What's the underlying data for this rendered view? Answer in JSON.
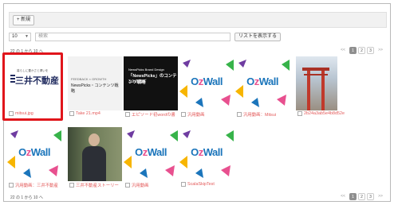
{
  "topbar": {
    "new_label": "+ 新規"
  },
  "toolbar": {
    "per_page_value": "10",
    "search_placeholder": "検索",
    "list_button_label": "リストを表示する"
  },
  "pagination": {
    "count_top": "22 の 1 から 10 へ",
    "count_bottom": "22 の 1 から 10 へ",
    "prev": "<<",
    "next": ">>",
    "pages": [
      "1",
      "2",
      "3"
    ],
    "current": "1"
  },
  "thumbnails": {
    "mitsui_tagline": "暮らしに豊かさと潤いを",
    "mitsui_logo": "三井不動産",
    "newspicks_top": "FEEDBACK × GROWTH",
    "newspicks_title": "NewsPicks・コンテンツ戦略",
    "dark_small": "NewsPicks Brand Design",
    "dark_title": "「NewsPicks」のコンテンツ戦略",
    "dark_sub": "3つのカギ",
    "ozwall_word_a": "O",
    "ozwall_word_b": "z",
    "ozwall_word_c": "Wall"
  },
  "items": [
    {
      "caption": "mitsui.jpg"
    },
    {
      "caption": "Take 21.mp4"
    },
    {
      "caption": "エピソード初wordの書"
    },
    {
      "caption": "汎用動画"
    },
    {
      "caption": "汎用動画：Mitsui"
    },
    {
      "caption": "2b24a3ab5e4b8d52e"
    },
    {
      "caption": "汎用動画：三井不動産"
    },
    {
      "caption": "三井不動産ストーリー"
    },
    {
      "caption": "汎用動画"
    },
    {
      "caption": "ScalaSkipTest"
    }
  ],
  "colors": {
    "highlight": "#e0151b",
    "caption": "#e35a5a",
    "oz_blue": "#1b75bb",
    "oz_pink": "#e8508f"
  }
}
